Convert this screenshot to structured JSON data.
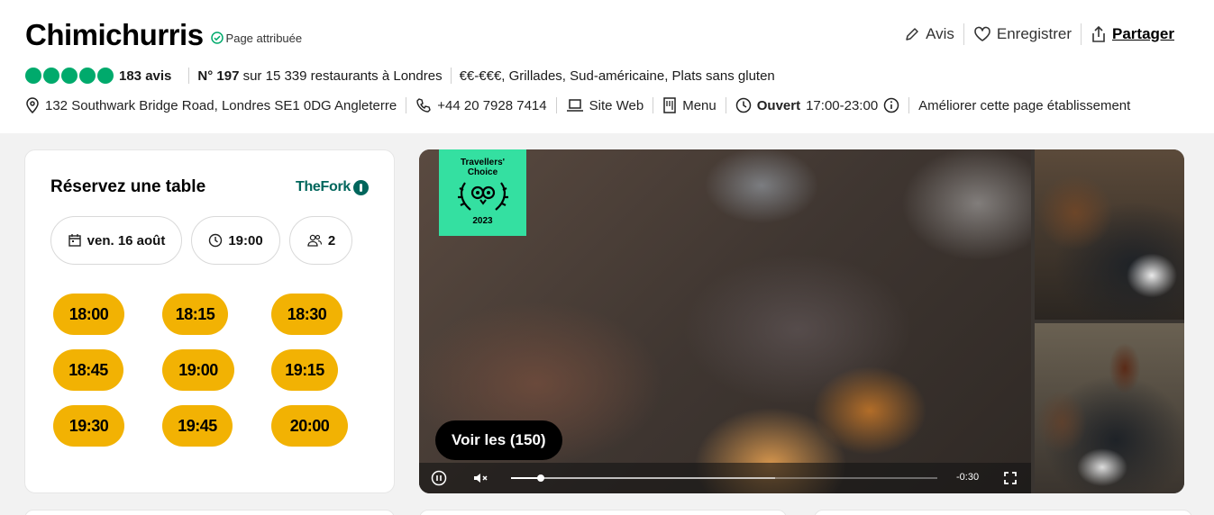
{
  "restaurant": {
    "name": "Chimichurris",
    "claimed_label": "Page attribuée"
  },
  "actions": {
    "review": "Avis",
    "save": "Enregistrer",
    "share": "Partager"
  },
  "rating": {
    "bubbles": 5,
    "reviews": "183 avis",
    "rank_number": "N° 197",
    "rank_text": "sur 15 339 restaurants à Londres",
    "cuisine": "€€-€€€, Grillades, Sud-américaine, Plats sans gluten"
  },
  "info": {
    "address": "132 Southwark Bridge Road, Londres SE1 0DG Angleterre",
    "phone": "+44 20 7928 7414",
    "website": "Site Web",
    "menu": "Menu",
    "open_label": "Ouvert",
    "hours": "17:00-23:00",
    "improve": "Améliorer cette page établissement"
  },
  "booking": {
    "title": "Réservez une table",
    "provider": "TheFork",
    "date": "ven. 16 août",
    "time": "19:00",
    "guests": "2",
    "slots": [
      "18:00",
      "18:15",
      "18:30",
      "18:45",
      "19:00",
      "19:15",
      "19:30",
      "19:45",
      "20:00"
    ]
  },
  "media": {
    "badge_line1": "Travellers'",
    "badge_line2": "Choice",
    "badge_year": "2023",
    "see_all": "Voir les (150)",
    "time_remaining": "-0:30",
    "progress": 0.07
  },
  "colors": {
    "rating_green": "#00aa6c",
    "slot_yellow": "#f2b203",
    "thefork_green": "#00665c",
    "badge_green": "#34e0a1"
  }
}
